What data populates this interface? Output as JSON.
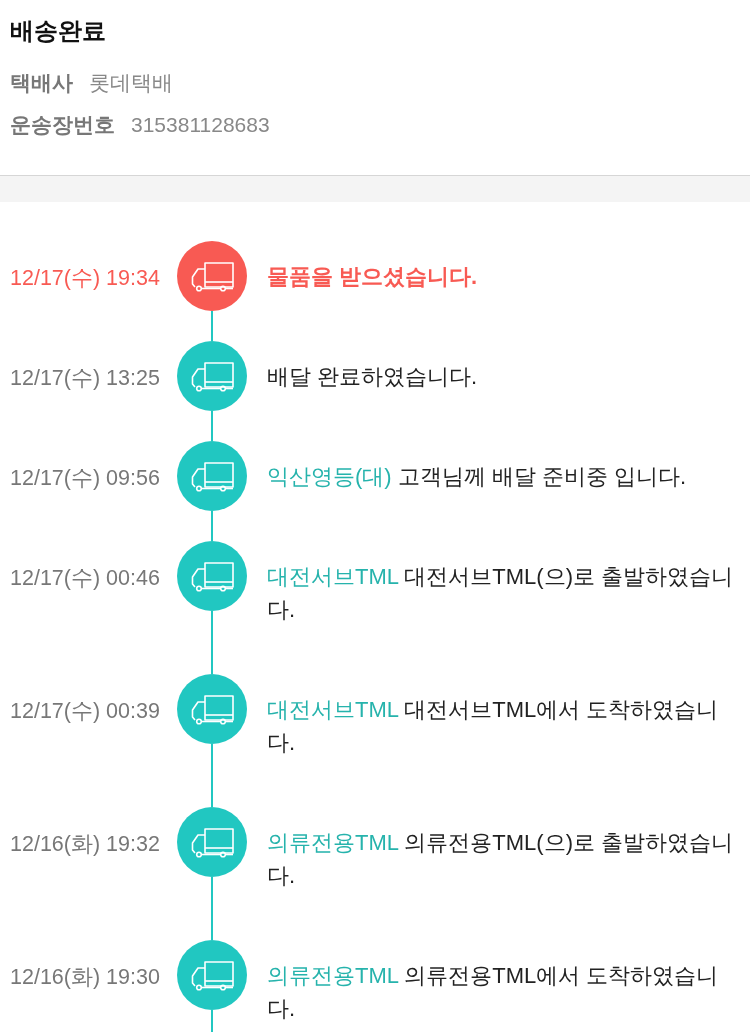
{
  "header": {
    "title": "배송완료",
    "fields": [
      {
        "label": "택배사",
        "value": "롯데택배"
      },
      {
        "label": "운송장번호",
        "value": "315381128683"
      }
    ]
  },
  "timeline": [
    {
      "time": "12/17(수) 19:34",
      "current": true,
      "message": "물품을 받으셨습니다."
    },
    {
      "time": "12/17(수) 13:25",
      "current": false,
      "message": "배달 완료하였습니다."
    },
    {
      "time": "12/17(수) 09:56",
      "current": false,
      "location": "익산영등(대)",
      "message": "고객님께 배달 준비중 입니다."
    },
    {
      "time": "12/17(수) 00:46",
      "current": false,
      "location": "대전서브TML",
      "message": "대전서브TML(으)로 출발하였습니다."
    },
    {
      "time": "12/17(수) 00:39",
      "current": false,
      "location": "대전서브TML",
      "message": "대전서브TML에서 도착하였습니다."
    },
    {
      "time": "12/16(화) 19:32",
      "current": false,
      "location": "의류전용TML",
      "message": "의류전용TML(으)로 출발하였습니다."
    },
    {
      "time": "12/16(화) 19:30",
      "current": false,
      "location": "의류전용TML",
      "message": "의류전용TML에서 도착하였습니다."
    }
  ]
}
